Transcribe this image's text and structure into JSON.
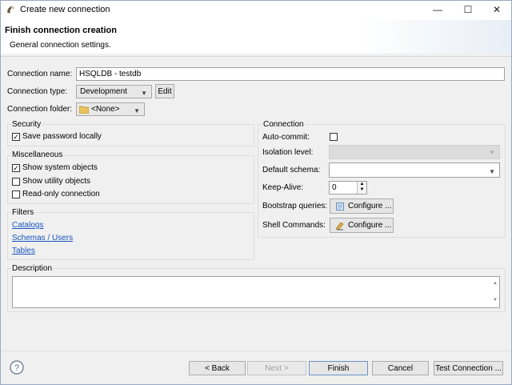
{
  "window": {
    "title": "Create new connection",
    "minimize": "—",
    "maximize": "☐",
    "close": "✕"
  },
  "header": {
    "title": "Finish connection creation",
    "subtitle": "General connection settings."
  },
  "general": {
    "name_label": "Connection name:",
    "name_value": "HSQLDB - testdb",
    "type_label": "Connection type:",
    "type_value": "Development",
    "edit_label": "Edit",
    "folder_label": "Connection folder:",
    "folder_value": "<None>"
  },
  "security": {
    "title": "Security",
    "save_password": {
      "label": "Save password locally",
      "checked": true
    }
  },
  "misc": {
    "title": "Miscellaneous",
    "items": [
      {
        "label": "Show system objects",
        "checked": true
      },
      {
        "label": "Show utility objects",
        "checked": false
      },
      {
        "label": "Read-only connection",
        "checked": false
      }
    ]
  },
  "filters": {
    "title": "Filters",
    "links": [
      "Catalogs",
      "Schemas / Users",
      "Tables"
    ]
  },
  "connection": {
    "title": "Connection",
    "autocommit_label": "Auto-commit:",
    "autocommit_checked": false,
    "isolation_label": "Isolation level:",
    "isolation_value": "",
    "schema_label": "Default schema:",
    "schema_value": "",
    "keepalive_label": "Keep-Alive:",
    "keepalive_value": "0",
    "bootstrap_label": "Bootstrap queries:",
    "shell_label": "Shell Commands:",
    "configure_label": "Configure ..."
  },
  "description": {
    "title": "Description",
    "value": ""
  },
  "footer": {
    "back": "< Back",
    "next": "Next >",
    "finish": "Finish",
    "cancel": "Cancel",
    "test": "Test Connection ..."
  }
}
